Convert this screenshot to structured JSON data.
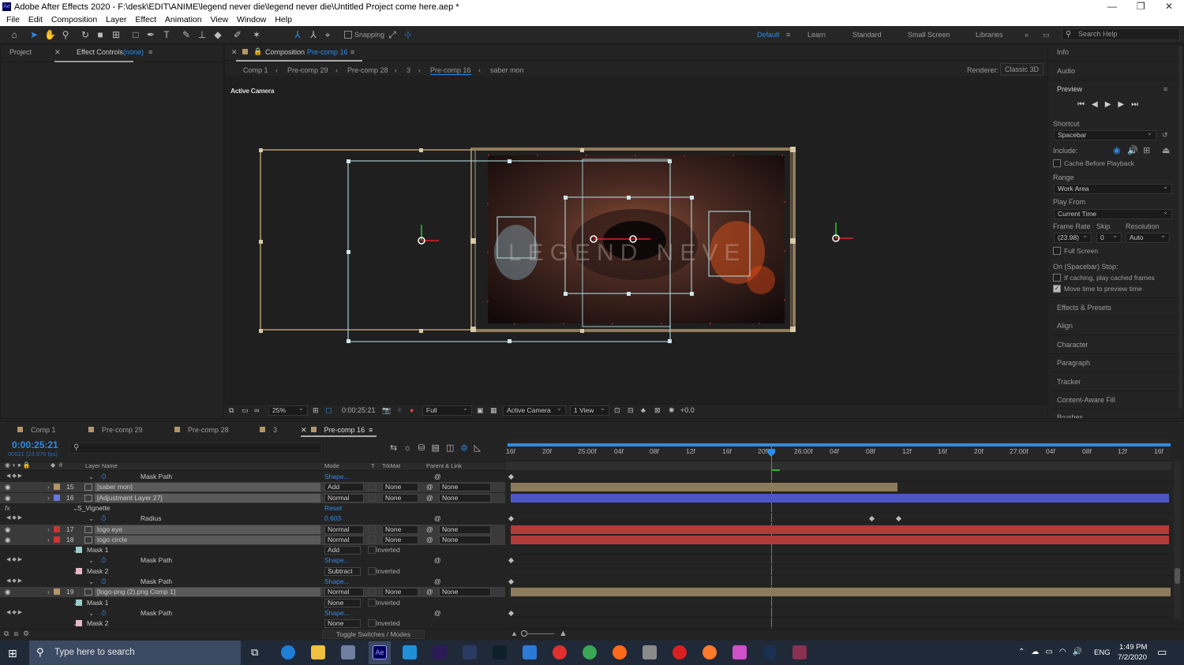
{
  "titlebar": {
    "title": "Adobe After Effects 2020 - F:\\desk\\EDIT\\ANIME\\legend never die\\legend never die\\Untitled Project come here.aep *",
    "icon": "Ae"
  },
  "menu": [
    "File",
    "Edit",
    "Composition",
    "Layer",
    "Effect",
    "Animation",
    "View",
    "Window",
    "Help"
  ],
  "toolbar": {
    "snapping": "Snapping",
    "workspaces": [
      "Default",
      "Learn",
      "Standard",
      "Small Screen",
      "Libraries"
    ],
    "search_placeholder": "Search Help"
  },
  "left_panel": {
    "tab_project": "Project",
    "tab_effect_controls": "Effect Controls",
    "effect_target": "(none)"
  },
  "comp_panel": {
    "header_label": "Composition",
    "header_comp": "Pre-comp 16",
    "breadcrumbs": [
      "Comp 1",
      "Pre-comp 29",
      "Pre-comp 28",
      "3",
      "Pre-comp 16",
      "saber mon"
    ],
    "renderer_label": "Renderer:",
    "renderer_value": "Classic 3D",
    "camera_label": "Active Camera",
    "watermark": "LEGEND NEVE"
  },
  "viewer_toolbar": {
    "zoom": "25%",
    "timecode": "0:00:25:21",
    "resolution": "Full",
    "camera": "Active Camera",
    "views": "1 View",
    "exposure": "+0.0"
  },
  "right_panel": {
    "items_top": [
      "Info",
      "Audio"
    ],
    "preview_title": "Preview",
    "shortcut_label": "Shortcut",
    "shortcut_value": "Spacebar",
    "include_label": "Include:",
    "cache_label": "Cache Before Playback",
    "range_label": "Range",
    "range_value": "Work Area",
    "play_from_label": "Play From",
    "play_from_value": "Current Time",
    "frame_rate_label": "Frame Rate",
    "skip_label": "Skip",
    "resolution_label": "Resolution",
    "frame_rate_value": "(23.98)",
    "skip_value": "0",
    "resolution_value": "Auto",
    "full_screen_label": "Full Screen",
    "stop_label": "On (Spacebar) Stop:",
    "cached_frames_label": "If caching, play cached frames",
    "move_time_label": "Move time to preview time",
    "items_bottom": [
      "Effects & Presets",
      "Align",
      "Character",
      "Paragraph",
      "Tracker",
      "Content-Aware Fill",
      "Brushes"
    ]
  },
  "timeline": {
    "tabs": [
      "Comp 1",
      "Pre-comp 29",
      "Pre-comp 28",
      "3",
      "Pre-comp 16"
    ],
    "timecode": "0:00:25:21",
    "frames": "00621 (23.976 fps)",
    "col_layer": "Layer Name",
    "col_mode": "Mode",
    "col_t": "T",
    "col_trkmat": "TrkMat",
    "col_parent": "Parent & Link",
    "ruler": [
      "16f",
      "20f",
      "25:00f",
      "04f",
      "08f",
      "12f",
      "16f",
      "20f",
      "26:00f",
      "04f",
      "08f",
      "12f",
      "16f",
      "20f",
      "27:00f",
      "04f",
      "08f",
      "12f",
      "16f"
    ],
    "toggle_label": "Toggle Switches / Modes",
    "rows": [
      {
        "num": "",
        "name": "Mask Path",
        "mode": "Shape...",
        "trk": "",
        "parent": "",
        "indent": 2,
        "type": "prop"
      },
      {
        "num": "15",
        "name": "[saber mon]",
        "mode": "Add",
        "trk": "None",
        "parent": "None",
        "indent": 0,
        "type": "layer",
        "color": "#b3956a",
        "bar": "#8c7a5c"
      },
      {
        "num": "16",
        "name": "[Adjustment Layer 27]",
        "mode": "Normal",
        "trk": "None",
        "parent": "None",
        "indent": 0,
        "type": "layer",
        "color": "#6677dd",
        "bar": "#4d57c4"
      },
      {
        "num": "",
        "name": "S_Vignette",
        "mode": "Reset",
        "trk": "",
        "parent": "",
        "indent": 1,
        "type": "fx"
      },
      {
        "num": "",
        "name": "Radius",
        "mode": "0.603",
        "trk": "",
        "parent": "",
        "indent": 2,
        "type": "prop"
      },
      {
        "num": "17",
        "name": "logo eye",
        "mode": "Normal",
        "trk": "None",
        "parent": "None",
        "indent": 0,
        "type": "layer",
        "color": "#cc3333",
        "bar": "#b33a3a"
      },
      {
        "num": "18",
        "name": "logo circle",
        "mode": "Normal",
        "trk": "None",
        "parent": "None",
        "indent": 0,
        "type": "layer",
        "color": "#cc3333",
        "bar": "#b33a3a"
      },
      {
        "num": "",
        "name": "Mask 1",
        "mode": "Add",
        "trk": "Inverted",
        "parent": "",
        "indent": 1,
        "type": "mask",
        "color": "#99cccc"
      },
      {
        "num": "",
        "name": "Mask Path",
        "mode": "Shape...",
        "trk": "",
        "parent": "",
        "indent": 2,
        "type": "prop"
      },
      {
        "num": "",
        "name": "Mask 2",
        "mode": "Subtract",
        "trk": "Inverted",
        "parent": "",
        "indent": 1,
        "type": "mask",
        "color": "#e8b8c8"
      },
      {
        "num": "",
        "name": "Mask Path",
        "mode": "Shape...",
        "trk": "",
        "parent": "",
        "indent": 2,
        "type": "prop"
      },
      {
        "num": "19",
        "name": "[logo-png (2).png Comp 1]",
        "mode": "Normal",
        "trk": "None",
        "parent": "None",
        "indent": 0,
        "type": "layer",
        "color": "#b3956a",
        "bar": "#8c7a5c"
      },
      {
        "num": "",
        "name": "Mask 1",
        "mode": "None",
        "trk": "Inverted",
        "parent": "",
        "indent": 1,
        "type": "mask",
        "color": "#99cccc"
      },
      {
        "num": "",
        "name": "Mask Path",
        "mode": "Shape...",
        "trk": "",
        "parent": "",
        "indent": 2,
        "type": "prop"
      },
      {
        "num": "",
        "name": "Mask 2",
        "mode": "None",
        "trk": "Inverted",
        "parent": "",
        "indent": 1,
        "type": "mask",
        "color": "#e8b8c8"
      }
    ]
  },
  "taskbar": {
    "search_placeholder": "Type here to search",
    "time": "1:49 PM",
    "date": "7/2/2020",
    "lang": "ENG"
  }
}
